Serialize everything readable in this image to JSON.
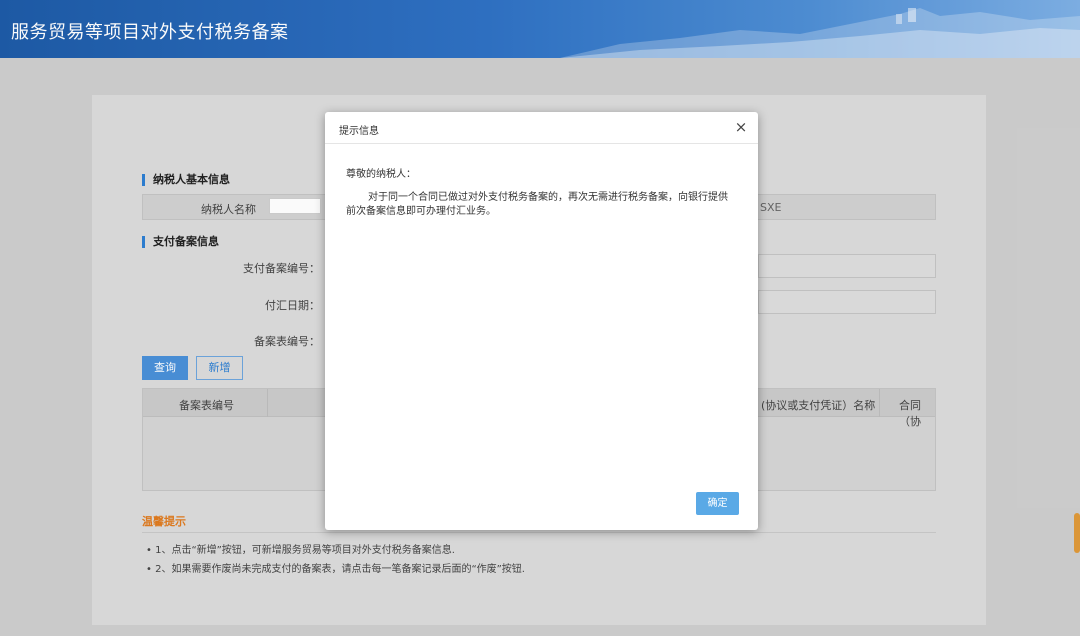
{
  "header": {
    "title": "服务贸易等项目对外支付税务备案"
  },
  "taxpayer_section": {
    "title": "纳税人基本信息",
    "name_label": "纳税人名称",
    "partial_value": "SXE"
  },
  "payment_section": {
    "title": "支付备案信息",
    "record_no_label": "支付备案编号：",
    "remit_date_label": "付汇日期：",
    "form_no_label": "备案表编号："
  },
  "buttons": {
    "query": "查询",
    "add": "新增"
  },
  "table": {
    "col1": "备案表编号",
    "col2": "(协议或支付凭证）名称",
    "col3": "合同（协"
  },
  "tips": {
    "title": "温馨提示",
    "items": [
      "• 1、点击“新增”按钮，可新增服务贸易等项目对外支付税务备案信息.",
      "• 2、如果需要作废尚未完成支付的备案表，请点击每一笔备案记录后面的“作废”按钮."
    ]
  },
  "modal": {
    "title": "提示信息",
    "close": "×",
    "greeting": "尊敬的纳税人：",
    "message": "对于同一个合同已做过对外支付税务备案的，再次无需进行税务备案，向银行提供前次备案信息即可办理付汇业务。",
    "ok": "确定"
  },
  "colors": {
    "primary": "#4a90d9",
    "accent": "#2d7fd3",
    "tips": "#e07b1f"
  }
}
